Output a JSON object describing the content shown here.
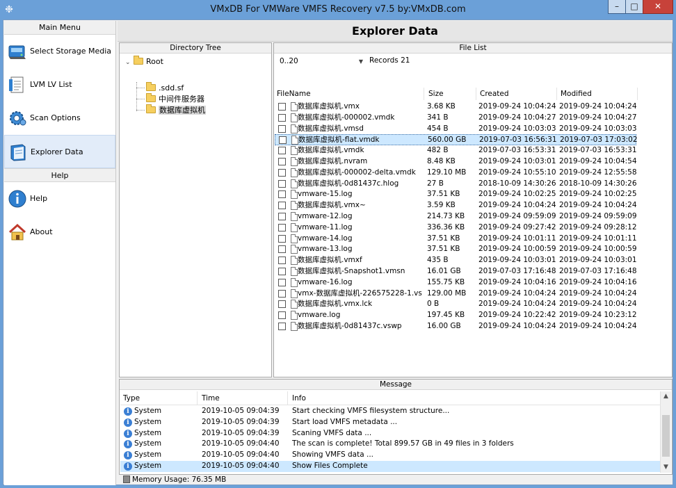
{
  "window": {
    "title": "VMxDB For VMWare VMFS Recovery v7.5 by:VMxDB.com",
    "minimize": "–",
    "maximize": "□",
    "close": "✕"
  },
  "menu": {
    "main_header": "Main Menu",
    "help_header": "Help",
    "items": [
      {
        "label": "Select Storage Media",
        "icon": "storage-media-icon"
      },
      {
        "label": "LVM LV List",
        "icon": "document-list-icon"
      },
      {
        "label": "Scan Options",
        "icon": "gear-icon"
      },
      {
        "label": "Explorer Data",
        "icon": "explorer-book-icon"
      }
    ],
    "help_items": [
      {
        "label": "Help",
        "icon": "info-icon"
      },
      {
        "label": "About",
        "icon": "home-icon"
      }
    ]
  },
  "page_title": "Explorer Data",
  "tree": {
    "header": "Directory Tree",
    "root": "Root",
    "children": [
      ".sdd.sf",
      "中间件服务器",
      "数据库虚拟机"
    ],
    "selected_index": 2
  },
  "filelist": {
    "header": "File List",
    "range": "0..20",
    "records": "Records 21",
    "columns": [
      "FileName",
      "Size",
      "Created",
      "Modified"
    ],
    "selected_row": 3,
    "rows": [
      [
        "数据库虚拟机.vmx",
        "3.68 KB",
        "2019-09-24 10:04:24",
        "2019-09-24 10:04:24"
      ],
      [
        "数据库虚拟机-000002.vmdk",
        "341 B",
        "2019-09-24 10:04:27",
        "2019-09-24 10:04:27"
      ],
      [
        "数据库虚拟机.vmsd",
        "454 B",
        "2019-09-24 10:03:03",
        "2019-09-24 10:03:03"
      ],
      [
        "数据库虚拟机-flat.vmdk",
        "560.00 GB",
        "2019-07-03 16:56:31",
        "2019-07-03 17:03:02"
      ],
      [
        "数据库虚拟机.vmdk",
        "482 B",
        "2019-07-03 16:53:31",
        "2019-07-03 16:53:31"
      ],
      [
        "数据库虚拟机.nvram",
        "8.48 KB",
        "2019-09-24 10:03:01",
        "2019-09-24 10:04:54"
      ],
      [
        "数据库虚拟机-000002-delta.vmdk",
        "129.10 MB",
        "2019-09-24 10:55:10",
        "2019-09-24 12:55:58"
      ],
      [
        "数据库虚拟机-0d81437c.hlog",
        "27 B",
        "2018-10-09 14:30:26",
        "2018-10-09 14:30:26"
      ],
      [
        "vmware-15.log",
        "37.51 KB",
        "2019-09-24 10:02:25",
        "2019-09-24 10:02:25"
      ],
      [
        "数据库虚拟机.vmx~",
        "3.59 KB",
        "2019-09-24 10:04:24",
        "2019-09-24 10:04:24"
      ],
      [
        "vmware-12.log",
        "214.73 KB",
        "2019-09-24 09:59:09",
        "2019-09-24 09:59:09"
      ],
      [
        "vmware-11.log",
        "336.36 KB",
        "2019-09-24 09:27:42",
        "2019-09-24 09:28:12"
      ],
      [
        "vmware-14.log",
        "37.51 KB",
        "2019-09-24 10:01:11",
        "2019-09-24 10:01:11"
      ],
      [
        "vmware-13.log",
        "37.51 KB",
        "2019-09-24 10:00:59",
        "2019-09-24 10:00:59"
      ],
      [
        "数据库虚拟机.vmxf",
        "435 B",
        "2019-09-24 10:03:01",
        "2019-09-24 10:03:01"
      ],
      [
        "数据库虚拟机-Snapshot1.vmsn",
        "16.01 GB",
        "2019-07-03 17:16:48",
        "2019-07-03 17:16:48"
      ],
      [
        "vmware-16.log",
        "155.75 KB",
        "2019-09-24 10:04:16",
        "2019-09-24 10:04:16"
      ],
      [
        "vmx-数据库虚拟机-226575228-1.vs...",
        "129.00 MB",
        "2019-09-24 10:04:24",
        "2019-09-24 10:04:24"
      ],
      [
        "数据库虚拟机.vmx.lck",
        "0 B",
        "2019-09-24 10:04:24",
        "2019-09-24 10:04:24"
      ],
      [
        "vmware.log",
        "197.45 KB",
        "2019-09-24 10:22:42",
        "2019-09-24 10:23:12"
      ],
      [
        "数据库虚拟机-0d81437c.vswp",
        "16.00 GB",
        "2019-09-24 10:04:24",
        "2019-09-24 10:04:24"
      ]
    ]
  },
  "message": {
    "header": "Message",
    "columns": [
      "Type",
      "Time",
      "Info"
    ],
    "selected_row": 5,
    "rows": [
      [
        "System",
        "2019-10-05 09:04:39",
        "Start checking VMFS filesystem structure..."
      ],
      [
        "System",
        "2019-10-05 09:04:39",
        "Start load VMFS metadata ..."
      ],
      [
        "System",
        "2019-10-05 09:04:39",
        "Scaning VMFS data ..."
      ],
      [
        "System",
        "2019-10-05 09:04:40",
        "The scan is complete!  Total 899.57 GB  in 49 files in 3 folders"
      ],
      [
        "System",
        "2019-10-05 09:04:40",
        "Showing VMFS data ..."
      ],
      [
        "System",
        "2019-10-05 09:04:40",
        "Show Files Complete"
      ]
    ]
  },
  "status": {
    "memory": "Memory Usage: 76.35 MB"
  }
}
